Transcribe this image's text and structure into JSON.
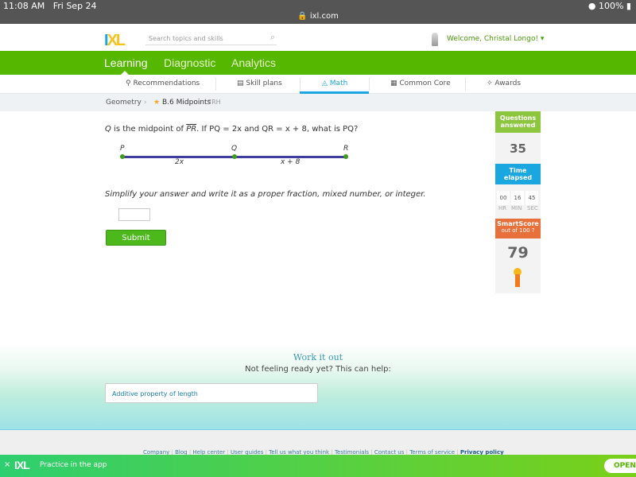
{
  "status_bar": {
    "time": "11:08 AM",
    "date": "Fri Sep 24",
    "battery": "100%",
    "url": "ixl.com"
  },
  "header": {
    "logo": "IXL",
    "search_placeholder": "Search topics and skills",
    "welcome": "Welcome, Christal Longo! ▾"
  },
  "nav": {
    "items": [
      "Learning",
      "Diagnostic",
      "Analytics"
    ],
    "active": "Learning"
  },
  "subnav": {
    "items": [
      "Recommendations",
      "Skill plans",
      "Math",
      "Common Core",
      "Awards"
    ],
    "icons": [
      "recommendations-icon",
      "skill-plans-icon",
      "math-icon",
      "common-core-icon",
      "awards-icon"
    ],
    "active": "Math"
  },
  "breadcrumb": {
    "subject": "Geometry",
    "skill": "B.6 Midpoints",
    "code": "7RH"
  },
  "question": {
    "q_var": "Q",
    "mid_text": " is the midpoint of ",
    "segment": "PR",
    "rest": ". If PQ = 2x and QR = x + 8, what is PQ?",
    "diagram": {
      "points": [
        "P",
        "Q",
        "R"
      ],
      "left_label": "2x",
      "right_label": "x + 8"
    },
    "instructions": "Simplify your answer and write it as a proper fraction, mixed number, or integer.",
    "answer_value": "",
    "submit": "Submit"
  },
  "sidebar": {
    "questions_label": "Questions answered",
    "questions": "35",
    "time_label": "Time elapsed",
    "hr": "00",
    "min": "16",
    "sec": "45",
    "hr_label": "HR",
    "min_label": "MIN",
    "sec_label": "SEC",
    "smartscore_label": "SmartScore",
    "smartscore_sub": "out of 100",
    "smartscore": "79"
  },
  "work": {
    "title": "Work it out",
    "subtitle": "Not feeling ready yet? This can help:",
    "link": "Additive property of length"
  },
  "footer": {
    "links": [
      "Company",
      "Blog",
      "Help center",
      "User guides",
      "Tell us what you think",
      "Testimonials",
      "Contact us",
      "Terms of service"
    ],
    "privacy": "Privacy policy"
  },
  "banner": {
    "close": "×",
    "logo": "IXL",
    "text": "Practice in the app",
    "open": "OPEN"
  },
  "colors": {
    "green": "#56b700",
    "blue": "#1aa6de",
    "orange": "#e8703a",
    "lime": "#8cc63f"
  }
}
